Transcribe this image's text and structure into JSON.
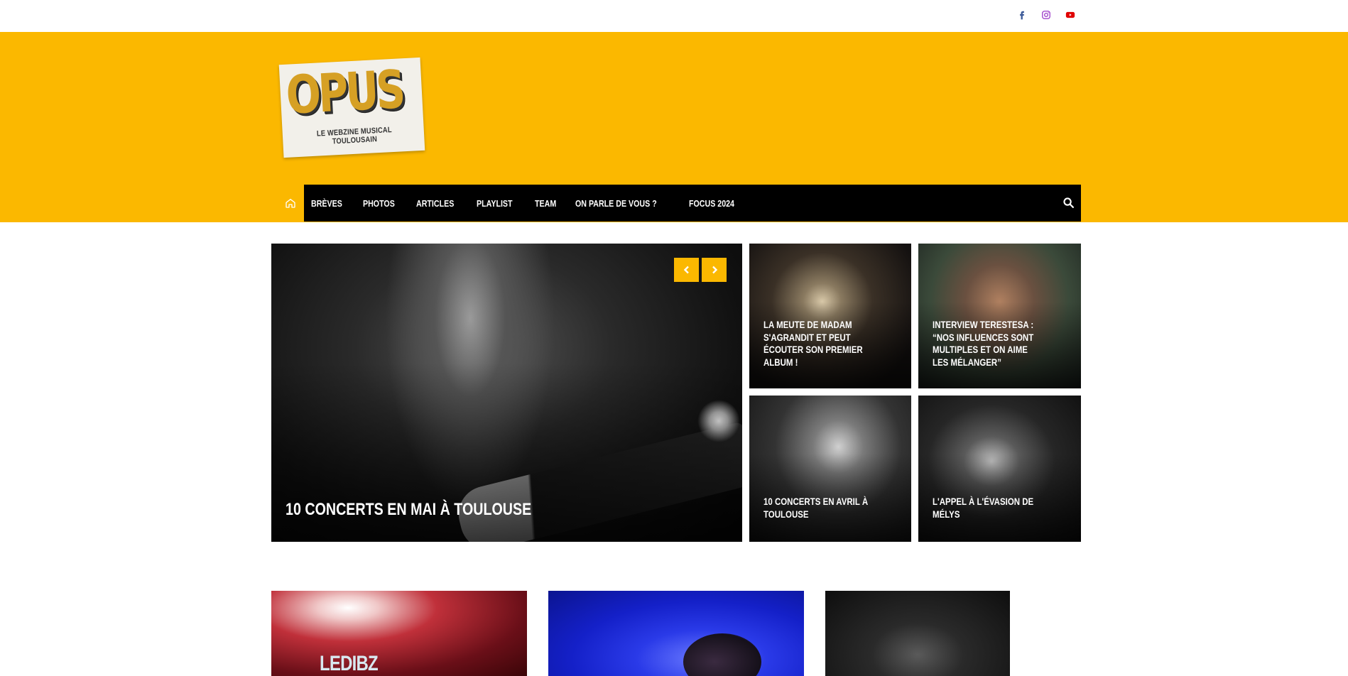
{
  "social": {
    "facebook": "facebook-icon",
    "instagram": "instagram-icon",
    "youtube": "youtube-icon"
  },
  "colors": {
    "brand_yellow": "#fbb800",
    "nav_black": "#000000",
    "facebook": "#3b5998",
    "instagram": "#9b3ac8",
    "youtube": "#e00000"
  },
  "logo": {
    "word": "OPUS",
    "tagline": "LE WEBZINE MUSICAL TOULOUSAIN"
  },
  "nav": {
    "home_icon": "home-icon",
    "items": [
      "Brèves",
      "Photos",
      "Articles",
      "Playlist",
      "Team",
      "On parle de vous ?",
      "Focus 2024"
    ],
    "search_icon": "search-icon"
  },
  "featured": {
    "main": "10 concerts en mai à Toulouse",
    "a": "La Meute de Madam s'agrandit et peut écouter son premier album !",
    "b": "Interview Terestesa : “Nos influences sont multiples et on aime les mélanger”",
    "c": "10 concerts en avril à Toulouse",
    "d": "L'appel à l'évasion de Mélys"
  },
  "cards": {
    "card1_text": "LEDIBZ"
  }
}
